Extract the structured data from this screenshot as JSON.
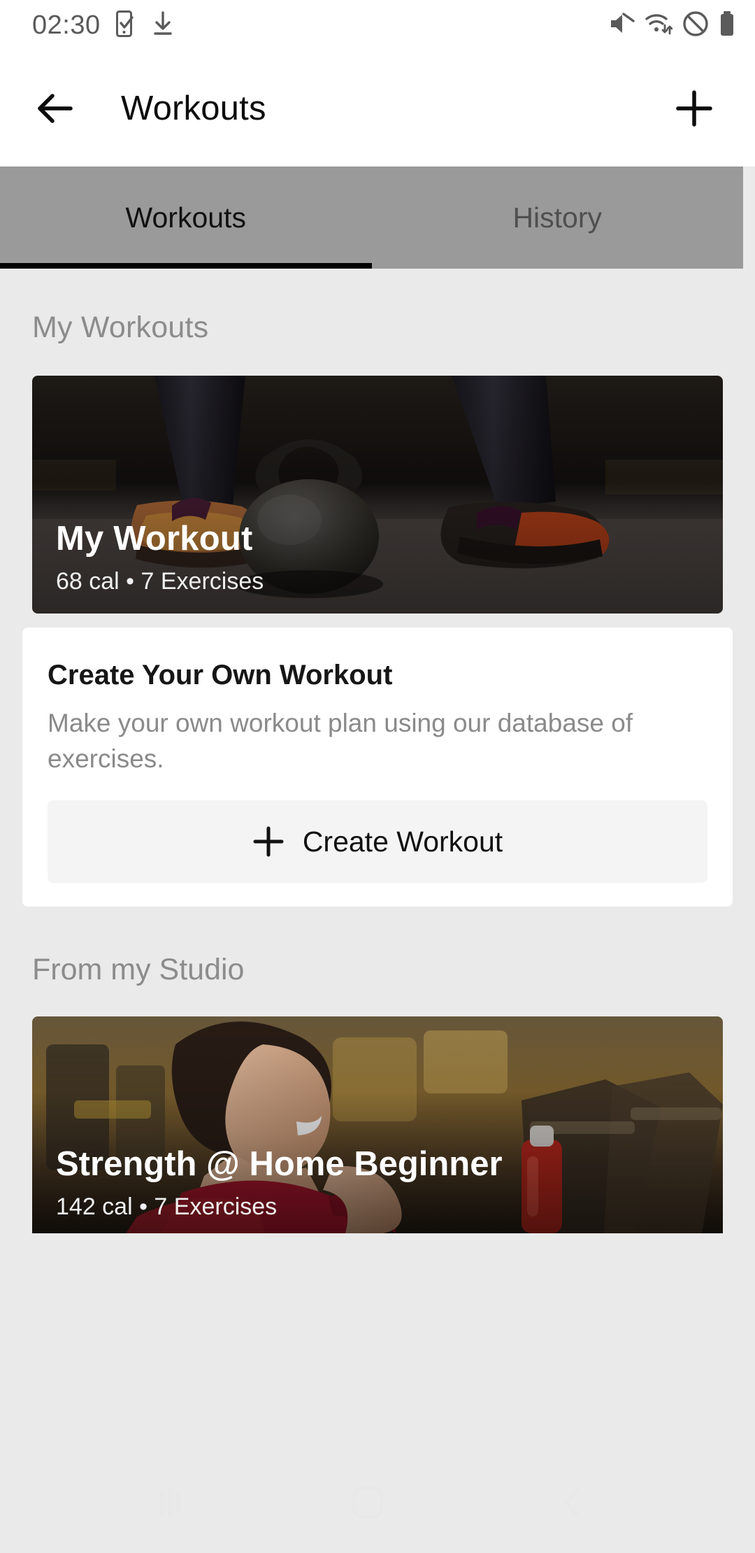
{
  "statusbar": {
    "time": "02:30",
    "left_icons": [
      "phone-check-icon",
      "download-icon"
    ],
    "right_icons": [
      "volume-mute-icon",
      "wifi-data-icon",
      "do-not-disturb-icon",
      "battery-full-icon"
    ]
  },
  "appbar": {
    "back_icon": "arrow-left-icon",
    "title": "Workouts",
    "add_icon": "plus-icon"
  },
  "tabs": {
    "items": [
      {
        "label": "Workouts",
        "active": true
      },
      {
        "label": "History",
        "active": false
      }
    ],
    "indicator_color": "#000000",
    "bar_color": "#9a9a9a"
  },
  "sections": {
    "my_workouts": {
      "title": "My Workouts",
      "hero": {
        "title": "My Workout",
        "subtitle": "68 cal • 7 Exercises",
        "calories": "68 cal",
        "exercises": "7 Exercises"
      },
      "create_card": {
        "title": "Create Your Own Workout",
        "description": "Make your own workout plan using our database of exercises.",
        "button_label": "Create Workout",
        "button_icon": "plus-icon"
      }
    },
    "from_my_studio": {
      "title": "From my Studio",
      "card": {
        "title": "Strength @ Home Beginner",
        "subtitle": "142 cal • 7 Exercises",
        "calories": "142 cal",
        "exercises": "7 Exercises"
      }
    }
  },
  "navhint": {
    "recent_icon": "recent-apps-icon",
    "home_icon": "home-square-icon",
    "back_icon": "back-chevron-icon"
  },
  "colors": {
    "page_background": "#eaeaea",
    "card_background": "#ffffff",
    "button_background": "#f4f4f4",
    "section_title": "#8c8c8c",
    "tab_bar": "#9a9a9a"
  }
}
